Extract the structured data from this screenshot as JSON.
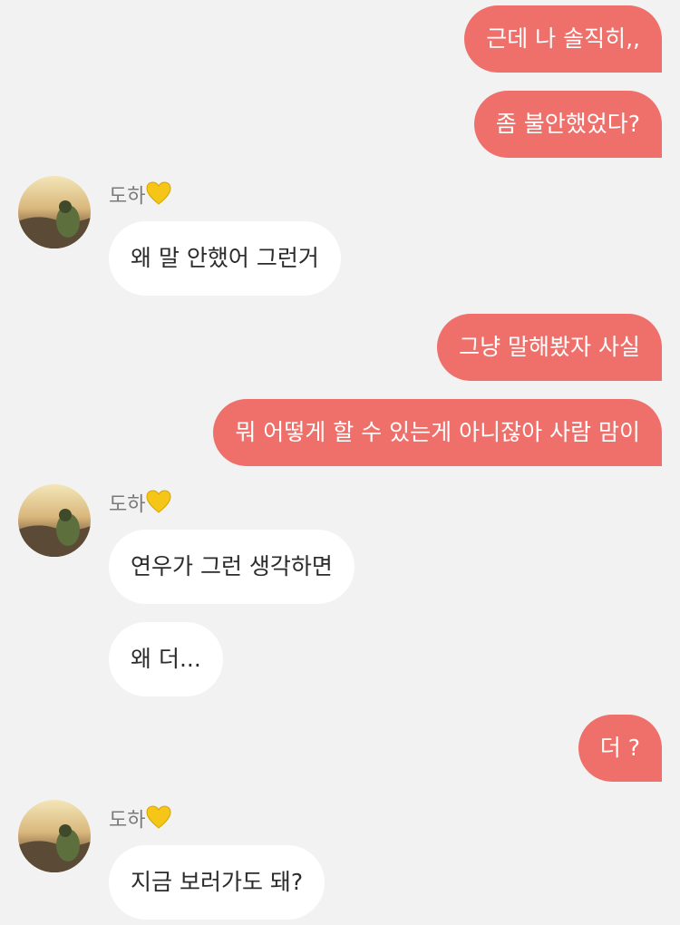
{
  "chat": {
    "sent": [
      "근데 나 솔직히,,",
      "좀 불안했었다?",
      "그냥 말해봤자 사실",
      "뭐 어떻게 할 수 있는게 아니잖아 사람 맘이",
      "더 ?"
    ],
    "received": [
      "왜 말 안했어 그런거",
      "연우가 그런 생각하면",
      "왜 더...",
      "지금 보러가도 돼?"
    ],
    "sender_name": "도하",
    "heart_icon": "yellow-heart-icon",
    "colors": {
      "background": "#f2f2f2",
      "sent_bubble": "#ef706b",
      "received_bubble": "#ffffff",
      "heart": "#f5c518"
    }
  }
}
